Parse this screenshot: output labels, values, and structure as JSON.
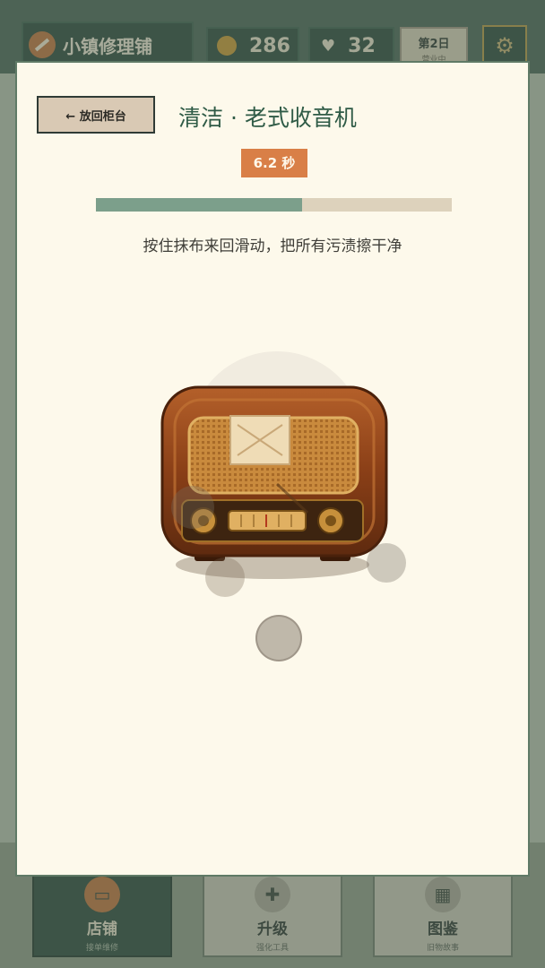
{
  "header": {
    "shop_name": "小镇修理铺",
    "coins": "286",
    "hearts": "32",
    "day_label": "第2日",
    "day_sub": "营业中",
    "icons": {
      "logo": "wrench-icon",
      "coins": "coin-icon",
      "hearts": "heart-icon",
      "settings": "gear-icon"
    }
  },
  "nav": {
    "items": [
      {
        "label": "店铺",
        "sub": "接单维修",
        "icon": "shop-icon"
      },
      {
        "label": "升级",
        "sub": "强化工具",
        "icon": "plus-icon"
      },
      {
        "label": "图鉴",
        "sub": "旧物故事",
        "icon": "grid-icon"
      }
    ]
  },
  "modal": {
    "back_label": "← 放回柜台",
    "title": "清洁 · 老式收音机",
    "timer": "6.2 秒",
    "progress": 0.58,
    "instruction": "按住抹布来回滑动，把所有污渍擦干净"
  },
  "colors": {
    "accent_orange": "#d97f47",
    "progress_fill": "#7c9f8b",
    "progress_track": "#ddd2bc",
    "panel_bg": "#fdf9eb",
    "title_green": "#2f5b46",
    "radio_wood": "#8a3f17"
  }
}
